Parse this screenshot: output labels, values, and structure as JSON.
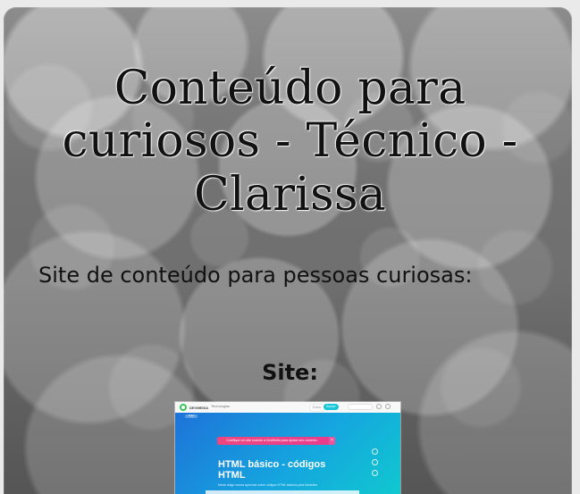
{
  "page": {
    "title": "Conteúdo para curiosos - Técnico - Clarissa",
    "subtitle": "Site de conteúdo para pessoas curiosas:",
    "section_heading": "Site:"
  },
  "preview": {
    "logo_text": "DEVMEDIA",
    "menu_text": "Tecnologias",
    "login_text": "Entrar",
    "signup_text": "Assine",
    "banner_text": "Codifique um site usando a DevMedia para ajudar seu cursinho",
    "headline": "HTML básico - códigos HTML",
    "description": "Neste artigo vamos aprender sobre códigos HTML básicos para iniciantes",
    "chip_text": "Artigo"
  },
  "icons": {
    "close": "close-icon",
    "user": "user-icon",
    "search": "search-icon",
    "share": "share-icon",
    "bookmark": "bookmark-icon"
  }
}
